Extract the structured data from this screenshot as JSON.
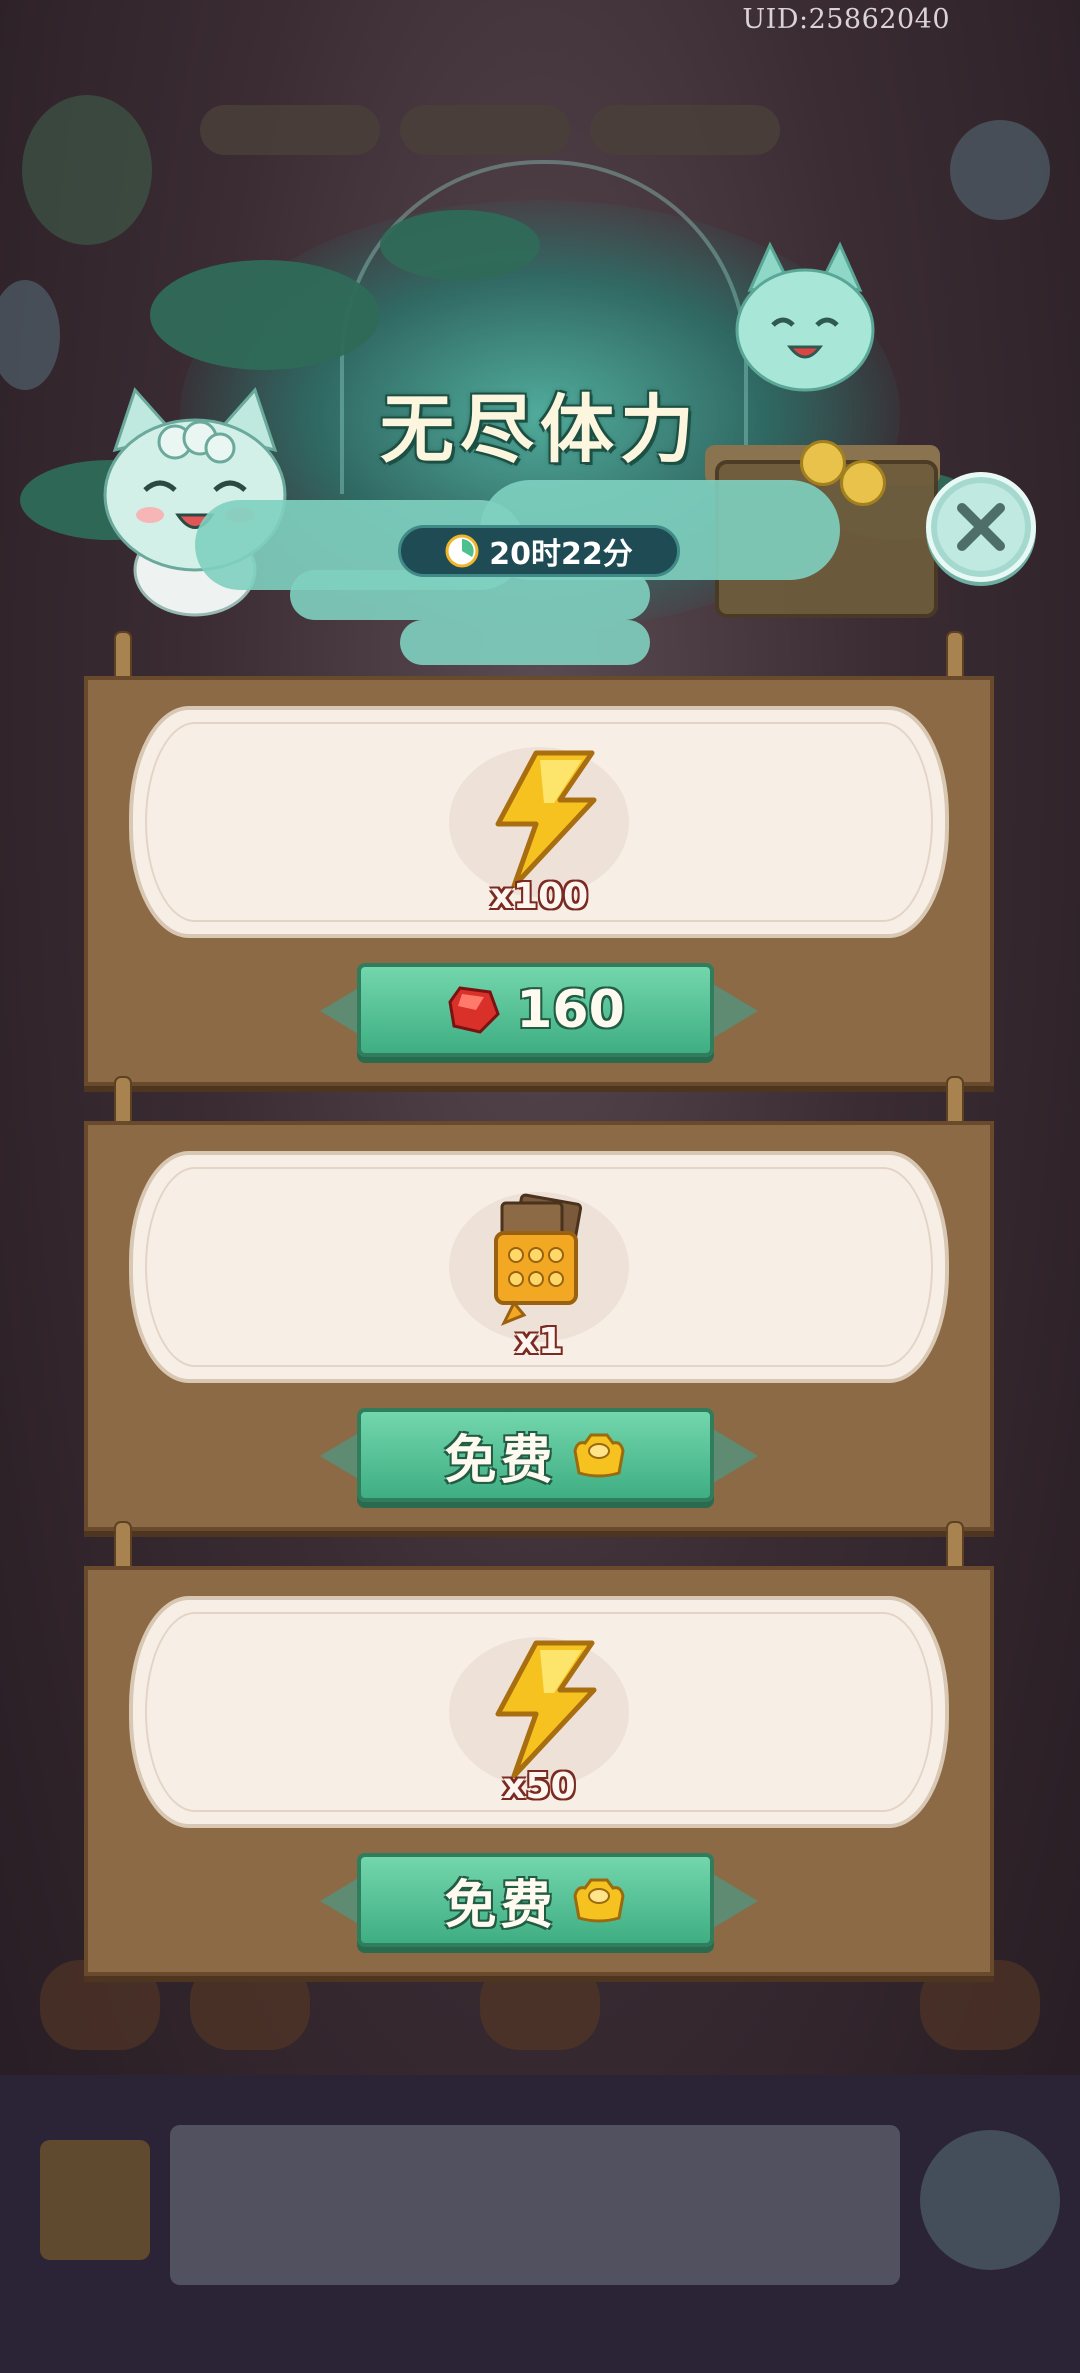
{
  "uid": "UID:25862040",
  "header": {
    "title": "无尽体力",
    "timer": "20时22分"
  },
  "offers": [
    {
      "item": "energy-bolt",
      "quantity": "x100",
      "button_label": "160",
      "currency": "ruby"
    },
    {
      "item": "scroll-pack",
      "quantity": "x1",
      "button_label": "免费",
      "currency": "gold-ingot"
    },
    {
      "item": "energy-bolt",
      "quantity": "x50",
      "button_label": "免费",
      "currency": "gold-ingot"
    }
  ],
  "colors": {
    "button_green": "#3fae82",
    "panel_brown": "#8c6a46",
    "card_cream": "#f7efe6",
    "header_teal": "#2f8c7c",
    "bolt_yellow": "#f5c21f",
    "ruby_red": "#d9302a"
  }
}
